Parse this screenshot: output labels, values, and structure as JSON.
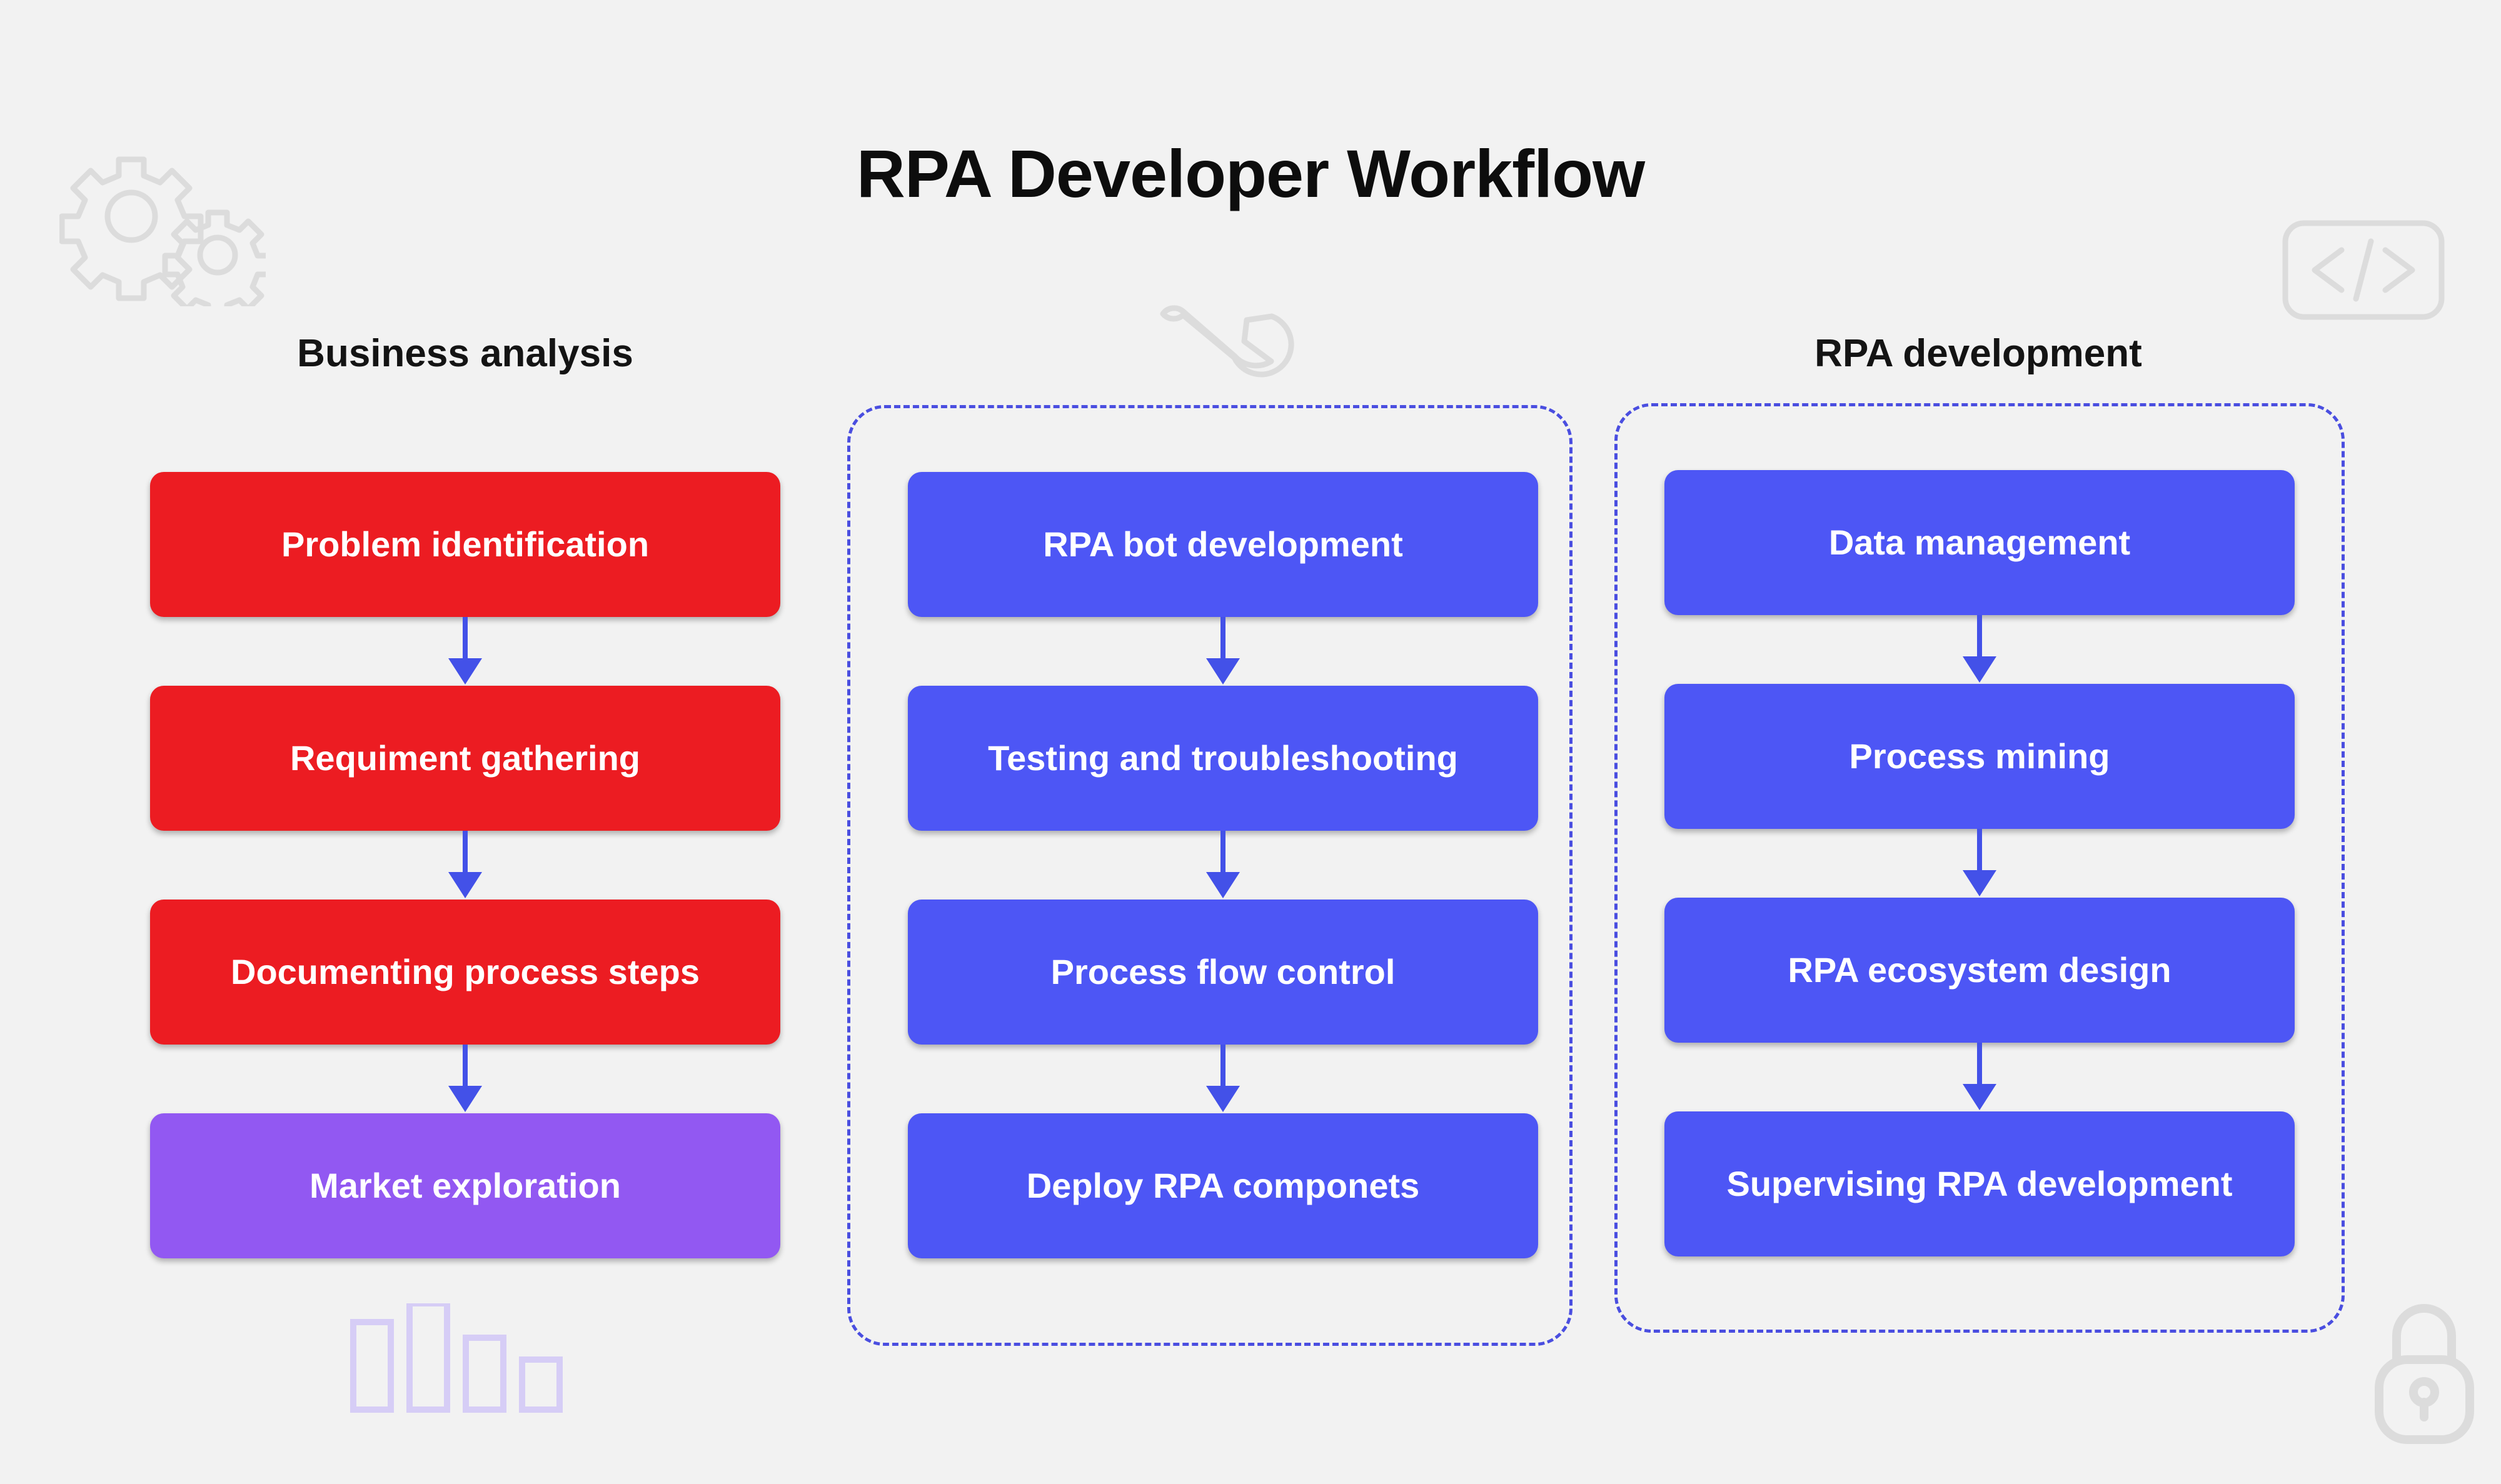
{
  "page": {
    "title": "RPA Developer Workflow",
    "background_color": "#f2f2f2"
  },
  "colors": {
    "red": "#ec1c22",
    "blue": "#4d56f5",
    "purple": "#9258f2",
    "arrow": "#4351e8",
    "dashed_border": "#4a4ee0",
    "title_text": "#0d0d0d",
    "node_text": "#ffffff",
    "decoration": "#dcdcdc",
    "decoration_bars": "#d6cdf6"
  },
  "columns": [
    {
      "id": "business-analysis",
      "header": "Business analysis",
      "grouped": false,
      "nodes": [
        {
          "label": "Problem identification",
          "color": "red"
        },
        {
          "label": "Requiment gathering",
          "color": "red"
        },
        {
          "label": "Documenting process steps",
          "color": "red"
        },
        {
          "label": "Market exploration",
          "color": "purple"
        }
      ]
    },
    {
      "id": "rpa-implementation",
      "header": "",
      "grouped": true,
      "nodes": [
        {
          "label": "RPA bot development",
          "color": "blue"
        },
        {
          "label": "Testing and troubleshooting",
          "color": "blue"
        },
        {
          "label": "Process flow control",
          "color": "blue"
        },
        {
          "label": "Deploy RPA componets",
          "color": "blue"
        }
      ]
    },
    {
      "id": "rpa-development",
      "header": "RPA development",
      "grouped": true,
      "nodes": [
        {
          "label": "Data management",
          "color": "blue"
        },
        {
          "label": "Process mining",
          "color": "blue"
        },
        {
          "label": "RPA ecosystem design",
          "color": "blue"
        },
        {
          "label": "Supervising RPA development",
          "color": "blue"
        }
      ]
    }
  ],
  "decorations": [
    {
      "name": "gears-icon",
      "position": "top-left"
    },
    {
      "name": "code-icon",
      "position": "top-right",
      "glyph": "</>"
    },
    {
      "name": "wrench-icon",
      "position": "top-center"
    },
    {
      "name": "lock-icon",
      "position": "bottom-right"
    },
    {
      "name": "bar-chart-icon",
      "position": "bottom-left"
    }
  ]
}
